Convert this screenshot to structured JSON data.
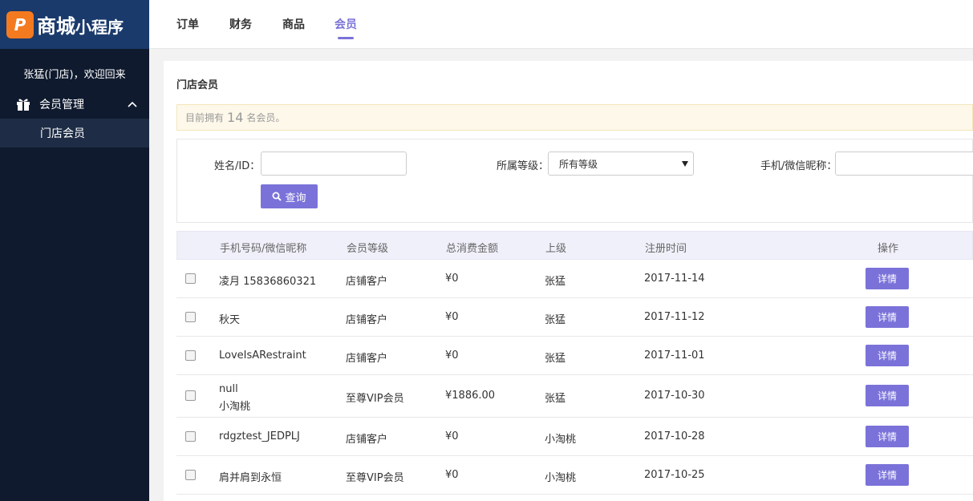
{
  "sidebar": {
    "logo_mark": "P",
    "logo_main": "商城",
    "logo_sub": "小程序",
    "welcome": "张猛(门店)，欢迎回来",
    "menu_group_label": "会员管理",
    "menu_sub_label": "门店会员"
  },
  "topnav": {
    "items": [
      "订单",
      "财务",
      "商品",
      "会员"
    ],
    "active_index": 3
  },
  "page": {
    "title": "门店会员",
    "notice_prefix": "目前拥有",
    "member_count": "14",
    "notice_suffix": "名会员。"
  },
  "filter": {
    "name_label": "姓名/ID：",
    "name_value": "",
    "level_label": "所属等级：",
    "level_value": "所有等级",
    "phone_label": "手机/微信昵称：",
    "phone_value": "",
    "search_label": "查询"
  },
  "table": {
    "headers": [
      "手机号码/微信昵称",
      "会员等级",
      "总消费金额",
      "上级",
      "注册时间",
      "操作"
    ],
    "detail_label": "详情",
    "rows": [
      {
        "name1": "凌月 15836860321",
        "name2": "",
        "level": "店铺客户",
        "amount": "¥0",
        "parent": "张猛",
        "date": "2017-11-14"
      },
      {
        "name1": "秋天",
        "name2": "",
        "level": "店铺客户",
        "amount": "¥0",
        "parent": "张猛",
        "date": "2017-11-12"
      },
      {
        "name1": "LoveIsARestraint",
        "name2": "",
        "level": "店铺客户",
        "amount": "¥0",
        "parent": "张猛",
        "date": "2017-11-01"
      },
      {
        "name1": "null",
        "name2": "小淘桃",
        "level": "至尊VIP会员",
        "amount": "¥1886.00",
        "parent": "张猛",
        "date": "2017-10-30"
      },
      {
        "name1": "rdgztest_JEDPLJ",
        "name2": "",
        "level": "店铺客户",
        "amount": "¥0",
        "parent": "小淘桃",
        "date": "2017-10-28"
      },
      {
        "name1": "肩并肩到永恒",
        "name2": "",
        "level": "至尊VIP会员",
        "amount": "¥0",
        "parent": "小淘桃",
        "date": "2017-10-25"
      }
    ]
  },
  "colors": {
    "accent": "#7a72d9",
    "sidebar_bg": "#0f1a2e",
    "logo_bg": "#1a3a6b",
    "logo_mark": "#f47a20"
  }
}
